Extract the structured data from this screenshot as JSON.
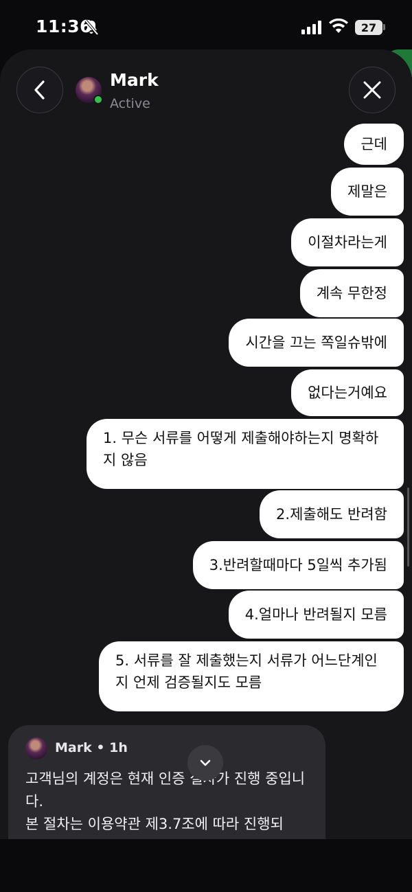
{
  "status_bar": {
    "time": "11:36",
    "battery": "27",
    "icons": [
      "bell-slash-icon",
      "signal-bars-icon",
      "wifi-icon",
      "battery-icon"
    ]
  },
  "header": {
    "contact_name": "Mark",
    "contact_status": "Active",
    "icons": [
      "back-chevron-icon",
      "close-x-icon"
    ]
  },
  "messages_outgoing": [
    {
      "text": "근데"
    },
    {
      "text": "제말은"
    },
    {
      "text": "이절차라는게"
    },
    {
      "text": "계속 무한정"
    },
    {
      "text": "시간을 끄는 쪽일슈밖에"
    },
    {
      "text": "없다는거예요"
    },
    {
      "text": "1. 무슨 서류를 어떻게 제출해야하는지 명확하지 않음"
    },
    {
      "text": "2.제출해도 반려함"
    },
    {
      "text": "3.반려할때마다 5일씩 추가됨"
    },
    {
      "text": "4.얼마나 반려될지 모름"
    },
    {
      "text": "5. 서류를 잘 제출했는지 서류가 어느단계인지 언제 검증될지도 모름"
    }
  ],
  "incoming": {
    "sender": "Mark • 1h",
    "text": "고객님의 계정은 현재 인증 절차가 진행 중입니다.\n본 절차는 이용약관 제3.7조에 따라 진행되"
  },
  "colors": {
    "background": "#0a0a0c",
    "sheet": "#17171a",
    "outgoing_bubble": "#ffffff",
    "incoming_bubble": "#2a2a2f",
    "online": "#35c24a"
  }
}
